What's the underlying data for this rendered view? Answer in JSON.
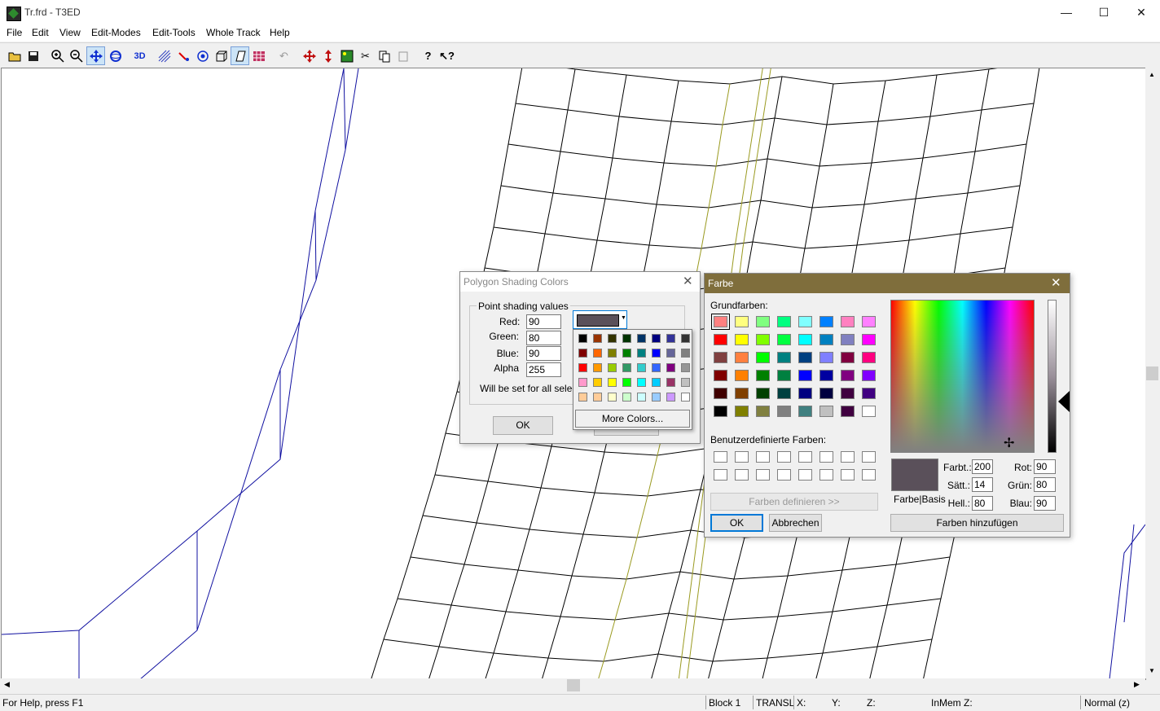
{
  "window": {
    "title": "Tr.frd - T3ED",
    "minimize": "—",
    "maximize": "☐",
    "close": "✕"
  },
  "menu": [
    {
      "label": "File"
    },
    {
      "label": "Edit"
    },
    {
      "label": "View"
    },
    {
      "label": "Edit-Modes"
    },
    {
      "label": "Edit-Tools"
    },
    {
      "label": "Whole Track"
    },
    {
      "label": "Help"
    }
  ],
  "toolbar_icons": [
    "open-icon",
    "save-icon",
    "zoom-in-icon",
    "zoom-out-icon",
    "move-icon",
    "rotate-icon",
    "3d-icon",
    "grid-icon",
    "link-icon",
    "target-icon",
    "cube-icon",
    "polygon-icon",
    "texture-icon",
    "undo-icon",
    "move-xy-icon",
    "move-z-icon",
    "image-icon",
    "cut-icon",
    "copy-icon",
    "paste-icon",
    "help-icon",
    "context-help-icon"
  ],
  "status": {
    "help": "For Help, press F1",
    "block": "Block 1",
    "mode": "TRANSL",
    "x": "X:",
    "y": "Y:",
    "z": "Z:",
    "inmem": "InMem Z:",
    "view": "Normal (z)"
  },
  "shading_dialog": {
    "title": "Polygon Shading Colors",
    "group_label": "Point shading values",
    "red_label": "Red:",
    "red_value": "90",
    "green_label": "Green:",
    "green_value": "80",
    "blue_label": "Blue:",
    "blue_value": "90",
    "alpha_label": "Alpha",
    "alpha_value": "255",
    "note": "Will be set for all selecte",
    "ok": "OK",
    "current_color": "#5a505a",
    "more_colors": "More Colors...",
    "palette": [
      [
        "#000000",
        "#993300",
        "#333300",
        "#003300",
        "#003366",
        "#000080",
        "#333399",
        "#333333"
      ],
      [
        "#800000",
        "#ff6600",
        "#808000",
        "#008000",
        "#008080",
        "#0000ff",
        "#666699",
        "#808080"
      ],
      [
        "#ff0000",
        "#ff9900",
        "#99cc00",
        "#339966",
        "#33cccc",
        "#3366ff",
        "#800080",
        "#969696"
      ],
      [
        "#ff99cc",
        "#ffcc00",
        "#ffff00",
        "#00ff00",
        "#00ffff",
        "#00ccff",
        "#993366",
        "#c0c0c0"
      ],
      [
        "#ffcc99",
        "#ffcc99",
        "#ffffcc",
        "#ccffcc",
        "#ccffff",
        "#99ccff",
        "#cc99ff",
        "#ffffff"
      ]
    ]
  },
  "farbe_dialog": {
    "title": "Farbe",
    "basic_label": "Grundfarben:",
    "custom_label": "Benutzerdefinierte Farben:",
    "define_button": "Farben definieren >>",
    "ok": "OK",
    "cancel": "Abbrechen",
    "add_button": "Farben hinzufügen",
    "preview_label": "Farbe|Basis",
    "hue_label": "Farbt.:",
    "hue_value": "200",
    "sat_label": "Sätt.:",
    "sat_value": "14",
    "lum_label": "Hell.:",
    "lum_value": "80",
    "red_label": "Rot:",
    "red_value": "90",
    "green_label": "Grün:",
    "green_value": "80",
    "blue_label": "Blau:",
    "blue_value": "90",
    "preview_color": "#5a505a",
    "basic_colors": [
      [
        "#ff8080",
        "#ffff80",
        "#80ff80",
        "#00ff80",
        "#80ffff",
        "#0080ff",
        "#ff80c0",
        "#ff80ff"
      ],
      [
        "#ff0000",
        "#ffff00",
        "#80ff00",
        "#00ff40",
        "#00ffff",
        "#0080c0",
        "#8080c0",
        "#ff00ff"
      ],
      [
        "#804040",
        "#ff8040",
        "#00ff00",
        "#008080",
        "#004080",
        "#8080ff",
        "#800040",
        "#ff0080"
      ],
      [
        "#800000",
        "#ff8000",
        "#008000",
        "#008040",
        "#0000ff",
        "#0000a0",
        "#800080",
        "#8000ff"
      ],
      [
        "#400000",
        "#804000",
        "#004000",
        "#004040",
        "#000080",
        "#000040",
        "#400040",
        "#400080"
      ],
      [
        "#000000",
        "#808000",
        "#808040",
        "#808080",
        "#408080",
        "#c0c0c0",
        "#400040",
        "#ffffff"
      ]
    ]
  }
}
